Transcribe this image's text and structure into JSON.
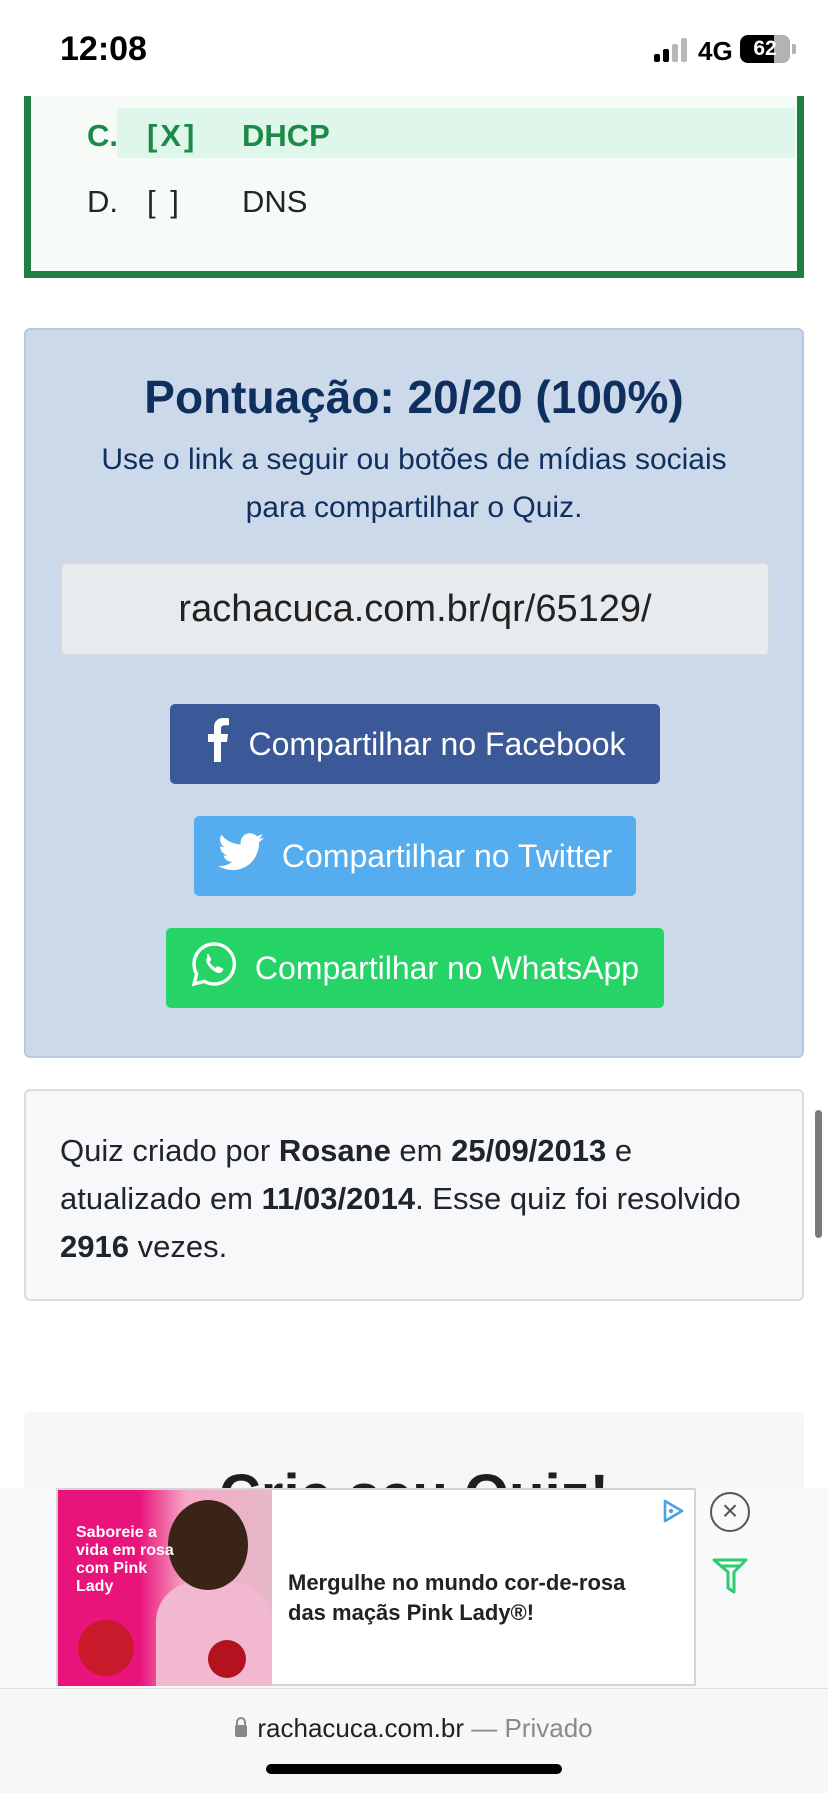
{
  "status_bar": {
    "time": "12:08",
    "network": "4G",
    "battery": "62"
  },
  "question": {
    "answers": [
      {
        "letter": "C.",
        "check": "[X]",
        "text": "DHCP",
        "correct": true
      },
      {
        "letter": "D.",
        "check": "[ ]",
        "text": "DNS",
        "correct": false
      }
    ]
  },
  "score": {
    "title": "Pontuação: 20/20 (100%)",
    "subtitle": "Use o link a seguir ou botões de mídias sociais para compartilhar o Quiz.",
    "link": "rachacuca.com.br/qr/65129/",
    "facebook_label": "Compartilhar no Facebook",
    "twitter_label": "Compartilhar no Twitter",
    "whatsapp_label": "Compartilhar no WhatsApp"
  },
  "info": {
    "text1": "Quiz criado por ",
    "author": "Rosane",
    "text2": " em ",
    "created": "25/09/2013",
    "text3": " e atualizado em ",
    "updated": "11/03/2014",
    "text4": ". Esse quiz foi resolvido ",
    "count": "2916",
    "text5": " vezes."
  },
  "next_card": {
    "title": "Crie seu Quiz!"
  },
  "ad": {
    "image_text": "Saboreie a vida em rosa com Pink Lady",
    "headline": "Mergulhe no mundo cor-de-rosa das maçãs Pink Lady®!"
  },
  "url_bar": {
    "domain": "rachacuca.com.br",
    "separator": " — ",
    "mode": "Privado"
  },
  "colors": {
    "green": "#1e7e44",
    "facebook": "#3b5998",
    "twitter": "#55acee",
    "whatsapp": "#25d366",
    "score_bg": "#ccd9ea"
  }
}
